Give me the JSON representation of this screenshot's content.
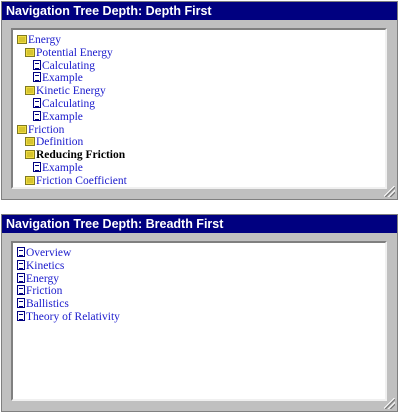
{
  "panels": [
    {
      "title": "Navigation Tree Depth: Depth First",
      "nodes": [
        {
          "label": "Energy",
          "level": 1,
          "icon": "folder-icon"
        },
        {
          "label": "Potential Energy",
          "level": 2,
          "icon": "folder-icon"
        },
        {
          "label": "Calculating",
          "level": 3,
          "icon": "document-icon"
        },
        {
          "label": "Example",
          "level": 3,
          "icon": "document-icon"
        },
        {
          "label": "Kinetic Energy",
          "level": 2,
          "icon": "folder-icon"
        },
        {
          "label": "Calculating",
          "level": 3,
          "icon": "document-icon"
        },
        {
          "label": "Example",
          "level": 3,
          "icon": "document-icon"
        },
        {
          "label": "Friction",
          "level": 1,
          "icon": "folder-icon"
        },
        {
          "label": "Definition",
          "level": 2,
          "icon": "folder-icon"
        },
        {
          "label": "Reducing Friction",
          "level": 2,
          "icon": "folder-icon",
          "current": true
        },
        {
          "label": "Example",
          "level": 3,
          "icon": "document-icon"
        },
        {
          "label": "Friction Coefficient",
          "level": 2,
          "icon": "folder-icon"
        }
      ]
    },
    {
      "title": "Navigation Tree Depth: Breadth First",
      "nodes": [
        {
          "label": "Overview",
          "level": 1,
          "icon": "document-icon"
        },
        {
          "label": "Kinetics",
          "level": 1,
          "icon": "document-icon"
        },
        {
          "label": "Energy",
          "level": 1,
          "icon": "document-icon"
        },
        {
          "label": "Friction",
          "level": 1,
          "icon": "document-icon"
        },
        {
          "label": "Ballistics",
          "level": 1,
          "icon": "document-icon"
        },
        {
          "label": "Theory of Relativity",
          "level": 1,
          "icon": "document-icon"
        }
      ]
    }
  ],
  "colors": {
    "title_bar": "#000080",
    "link": "#1a1acc",
    "current": "#000000",
    "panel_background": "#c0c0c0"
  }
}
